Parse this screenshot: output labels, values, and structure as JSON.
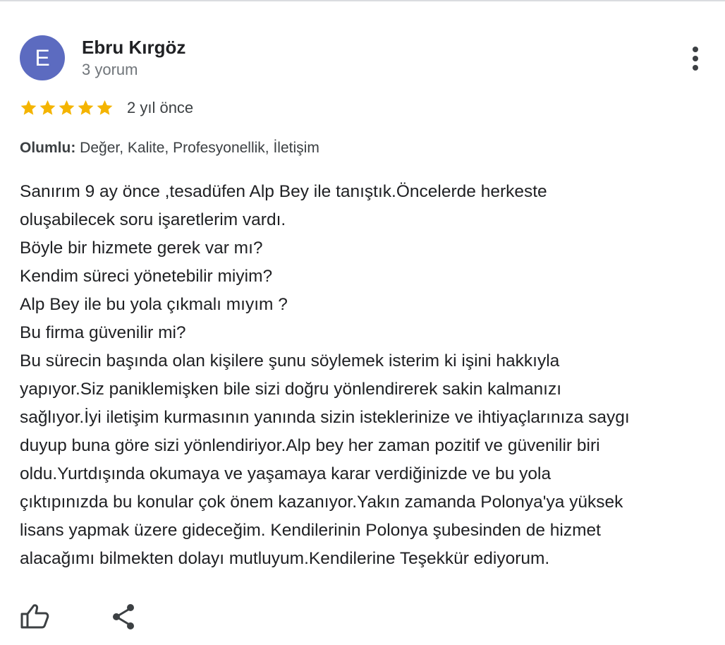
{
  "review": {
    "author": {
      "initial": "E",
      "name": "Ebru Kırgöz",
      "review_count": "3 yorum",
      "avatar_color": "#5c6bc0"
    },
    "rating": 5,
    "rating_max": 5,
    "star_color": "#f4b400",
    "time_ago": "2 yıl önce",
    "positives": {
      "label": "Olumlu:",
      "values": "Değer, Kalite, Profesyonellik, İletişim"
    },
    "text_lines": [
      "Sanırım 9 ay önce ,tesadüfen Alp Bey ile tanıştık.Öncelerde herkeste",
      "oluşabilecek soru işaretlerim vardı.",
      "Böyle bir hizmete gerek var mı?",
      "Kendim süreci yönetebilir miyim?",
      "Alp Bey ile bu yola çıkmalı mıyım ?",
      "Bu firma güvenilir mi?",
      "Bu sürecin başında olan kişilere şunu söylemek isterim ki işini hakkıyla",
      "yapıyor.Siz paniklemişken bile sizi doğru yönlendirerek sakin kalmanızı",
      "sağlıyor.İyi iletişim kurmasının yanında sizin isteklerinize ve ihtiyaçlarınıza saygı",
      "duyup buna göre sizi yönlendiriyor.Alp bey her zaman pozitif ve güvenilir biri",
      "oldu.Yurtdışında okumaya ve yaşamaya karar verdiğinizde ve bu yola",
      "çıktıpınızda bu konular çok önem kazanıyor.Yakın zamanda Polonya'ya yüksek",
      "lisans yapmak üzere gideceğim. Kendilerinin Polonya şubesinden de hizmet",
      "alacağımı bilmekten dolayı mutluyum.Kendilerine Teşekkür ediyorum."
    ],
    "actions": {
      "more_icon": "more-vertical-icon",
      "like_icon": "thumbs-up-icon",
      "share_icon": "share-icon"
    }
  }
}
